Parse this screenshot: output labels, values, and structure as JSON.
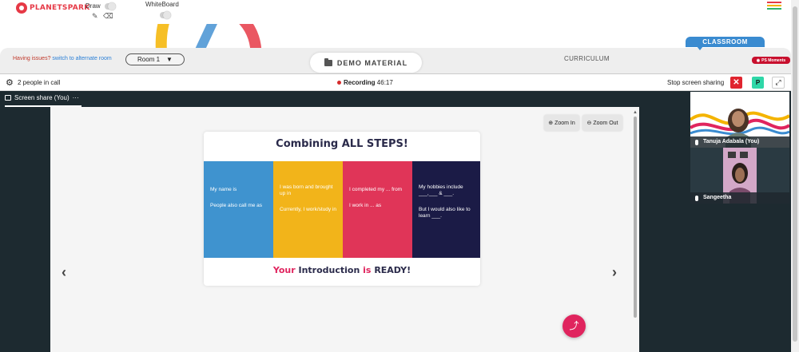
{
  "topbar": {
    "brand": "PLANETSPARK",
    "draw_label": "Draw",
    "whiteboard_label": "WhiteBoard",
    "menu_colors": [
      "#e63946",
      "#f4b400",
      "#2fb36b",
      "#3a8bd0"
    ]
  },
  "material_bar": {
    "issues_text": "Having issues?",
    "issues_link": "switch to alternate room",
    "room_select": "Room 1",
    "room_caret": "▼",
    "demo_tab": "DEMO MATERIAL",
    "curriculum_tab": "CURRICULUM",
    "classroom_tab": "CLASSROOM",
    "ps_moments": "PS Moments"
  },
  "call_bar": {
    "people_count": "2 people in call",
    "recording_label": "Recording",
    "recording_time": "46:17",
    "stop_sharing": "Stop screen sharing",
    "close_glyph": "✕",
    "p_glyph": "P",
    "expand_glyph": "⤢"
  },
  "share_tab": {
    "label": "Screen share (You)",
    "more": "···"
  },
  "viewer": {
    "zoom_in": "Zoom In",
    "zoom_out": "Zoom Out",
    "prev": "‹",
    "next": "›"
  },
  "slide": {
    "title": "Combining ALL STEPS!",
    "panels": [
      {
        "color": "#3f93cf",
        "lines": [
          "My name is",
          "People also call me as"
        ]
      },
      {
        "color": "#f2b41a",
        "lines": [
          "I was born and brought up in",
          "Currently, I work/study in"
        ]
      },
      {
        "color": "#e03558",
        "lines": [
          "I completed my ... from",
          "I work in ... as"
        ]
      },
      {
        "color": "#1b1b46",
        "lines": [
          "My hobbies include ___,___ & ___.",
          "But I would also like to learn ___."
        ]
      }
    ],
    "footer_your": "Your",
    "footer_intro": "Introduction",
    "footer_is": "is",
    "footer_ready": "READY!"
  },
  "participants": [
    {
      "name": "Tanuja Adabala (You)"
    },
    {
      "name": "Sangeetha"
    }
  ]
}
